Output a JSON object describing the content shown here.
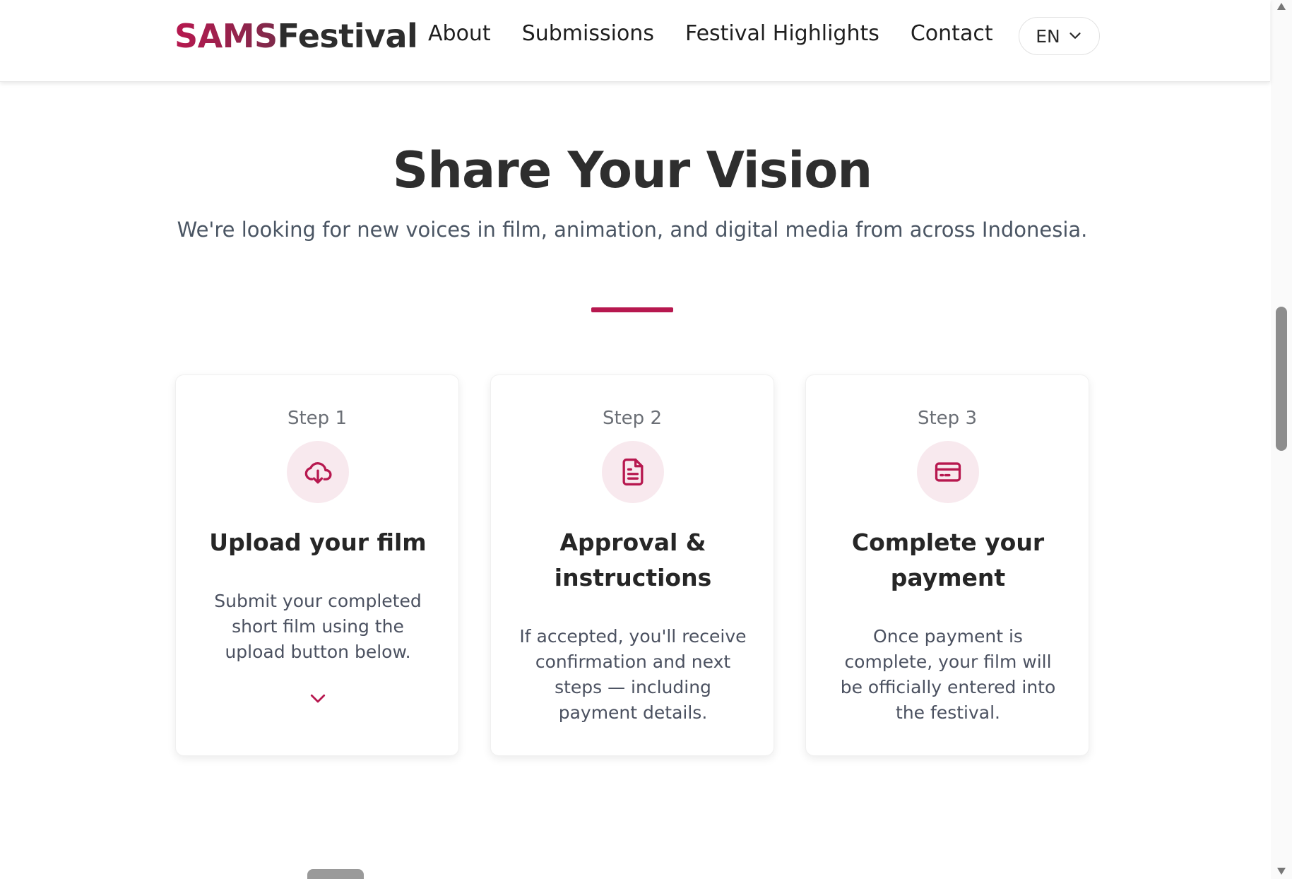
{
  "header": {
    "logo_sams": "SAMS",
    "logo_festival": "Festival",
    "nav": [
      "About",
      "Submissions",
      "Festival Highlights",
      "Contact"
    ],
    "language": "EN"
  },
  "hero": {
    "title": "Share Your Vision",
    "subtitle": "We're looking for new voices in film, animation, and digital media from across Indonesia."
  },
  "steps": [
    {
      "label": "Step 1",
      "icon": "cloud-download-icon",
      "title": "Upload your film",
      "description": "Submit your completed short film using the upload button below."
    },
    {
      "label": "Step 2",
      "icon": "document-icon",
      "title": "Approval & instructions",
      "description": "If accepted, you'll receive confirmation and next steps — including payment details."
    },
    {
      "label": "Step 3",
      "icon": "credit-card-icon",
      "title": "Complete your payment",
      "description": "Once payment is complete, your film will be officially entered into the festival."
    }
  ],
  "colors": {
    "accent": "#b7184f",
    "icon_bg": "#f8e9ee",
    "text_dark": "#2e2e2e",
    "text_muted": "#4a5563"
  }
}
